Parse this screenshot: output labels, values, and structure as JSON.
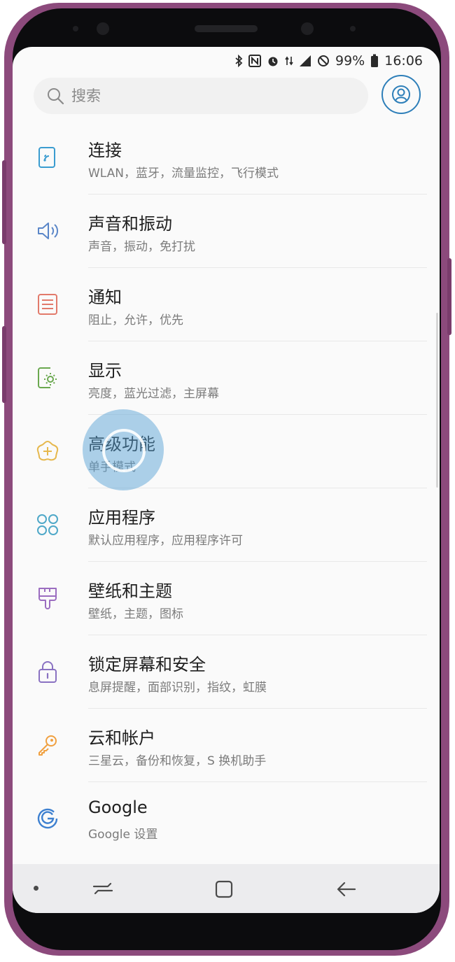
{
  "status_bar": {
    "battery": "99%",
    "time": "16:06"
  },
  "search": {
    "placeholder": "搜索"
  },
  "menu": [
    {
      "key": "connections",
      "icon": "connections-icon",
      "color": "#3a9cd0",
      "title": "连接",
      "subtitle": "WLAN，蓝牙，流量监控，飞行模式"
    },
    {
      "key": "sounds",
      "icon": "sound-icon",
      "color": "#5a86c8",
      "title": "声音和振动",
      "subtitle": "声音，振动，免打扰"
    },
    {
      "key": "notifications",
      "icon": "notification-icon",
      "color": "#e27a6b",
      "title": "通知",
      "subtitle": "阻止，允许，优先"
    },
    {
      "key": "display",
      "icon": "display-icon",
      "color": "#6aa84f",
      "title": "显示",
      "subtitle": "亮度，蓝光过滤，主屏幕"
    },
    {
      "key": "advanced",
      "icon": "advanced-features-icon",
      "color": "#e6b84d",
      "title": "高级功能",
      "subtitle": "单手模式"
    },
    {
      "key": "apps",
      "icon": "apps-icon",
      "color": "#4fa8c8",
      "title": "应用程序",
      "subtitle": "默认应用程序，应用程序许可"
    },
    {
      "key": "wallpapers",
      "icon": "wallpaper-themes-icon",
      "color": "#9b6dc0",
      "title": "壁纸和主题",
      "subtitle": "壁纸，主题，图标"
    },
    {
      "key": "lockscreen",
      "icon": "lock-icon",
      "color": "#8a72c2",
      "title": "锁定屏幕和安全",
      "subtitle": "息屏提醒，面部识别，指纹，虹膜"
    },
    {
      "key": "cloud",
      "icon": "key-icon",
      "color": "#f0a040",
      "title": "云和帐户",
      "subtitle": "三星云，备份和恢复，S 换机助手"
    },
    {
      "key": "google",
      "icon": "google-icon",
      "color": "#3d80d0",
      "title": "Google",
      "subtitle": "Google 设置"
    }
  ],
  "colors": {
    "accent": "#2e7fb9",
    "touch_indicator": "#56a0d6",
    "phone_frame": "#8c4a7c"
  }
}
